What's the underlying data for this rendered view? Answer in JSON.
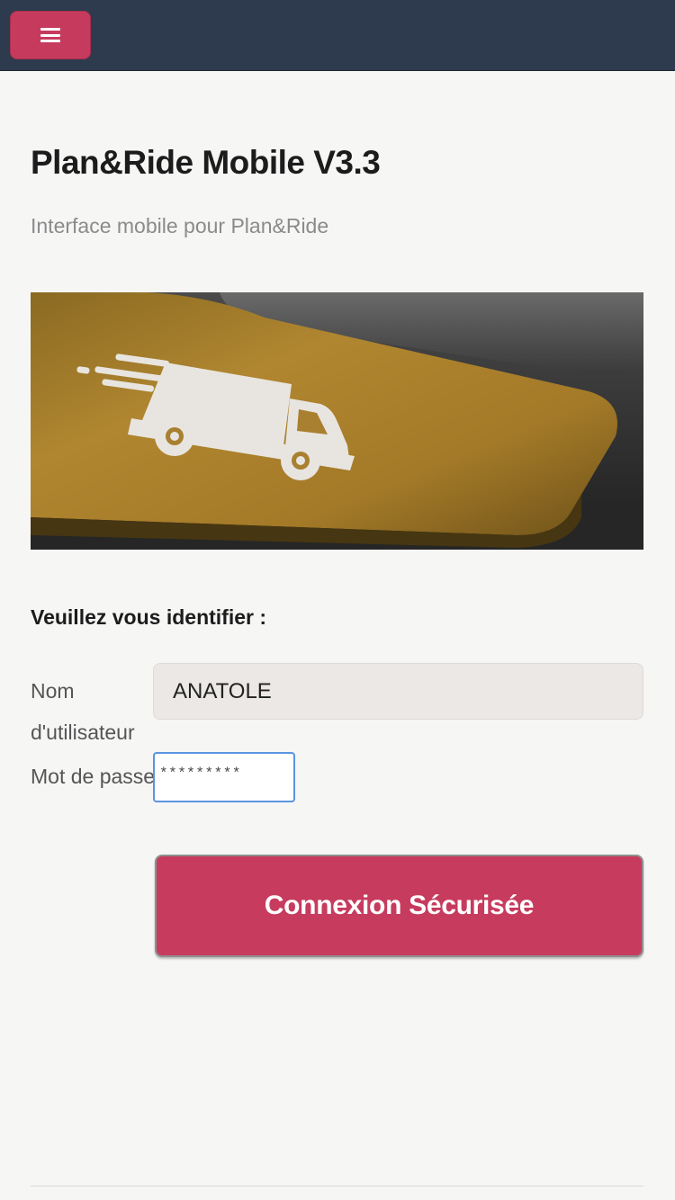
{
  "header": {
    "menu_icon": "hamburger-menu-icon"
  },
  "page": {
    "title": "Plan&Ride Mobile V3.3",
    "subtitle": "Interface mobile pour Plan&Ride"
  },
  "hero": {
    "icon": "delivery-truck-icon"
  },
  "login": {
    "heading": "Veuillez vous identifier :",
    "username_label": "Nom d'utilisateur",
    "username_value": "ANATOLE",
    "password_label": "Mot de passe",
    "password_value": "*********",
    "submit_label": "Connexion Sécurisée"
  },
  "colors": {
    "topbar": "#2e3a4d",
    "accent": "#c63b5d",
    "input_focus": "#5a95e0"
  }
}
